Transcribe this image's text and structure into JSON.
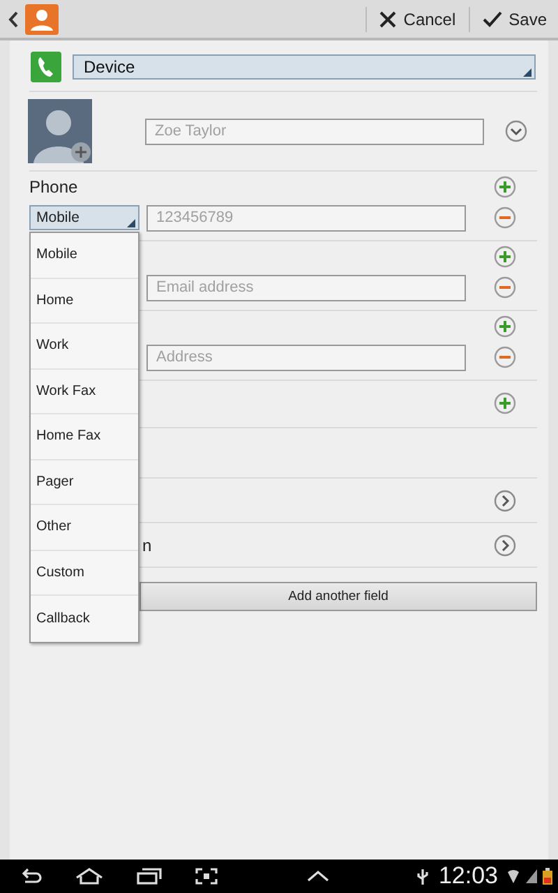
{
  "top_bar": {
    "actions": [
      {
        "kind": "cancel",
        "label": "Cancel"
      },
      {
        "kind": "save",
        "label": "Save"
      }
    ]
  },
  "account": {
    "value": "Device"
  },
  "name_field": {
    "placeholder": "Zoe Taylor"
  },
  "sections": [
    {
      "kind": "group",
      "label": "Phone",
      "field": {
        "type": "Mobile",
        "placeholder": "123456789"
      }
    },
    {
      "kind": "group",
      "field": {
        "placeholder": "Email address"
      }
    },
    {
      "kind": "group",
      "field": {
        "placeholder": "Address"
      }
    },
    {
      "kind": "group"
    },
    {
      "kind": "blank"
    },
    {
      "kind": "link"
    },
    {
      "kind": "link",
      "label": "n"
    }
  ],
  "add_field_button": "Add another field",
  "type_menu": [
    "Mobile",
    "Home",
    "Work",
    "Work Fax",
    "Home Fax",
    "Pager",
    "Other",
    "Custom",
    "Callback"
  ],
  "status_bar": {
    "time": "12:03"
  }
}
